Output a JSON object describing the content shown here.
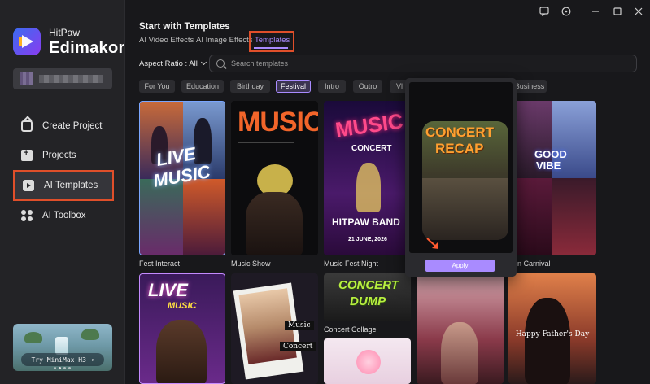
{
  "app": {
    "brand_top": "HitPaw",
    "brand_main": "Edimakor"
  },
  "sidebar": {
    "items": [
      {
        "label": "Create Project",
        "icon": "home-icon"
      },
      {
        "label": "Projects",
        "icon": "folder-icon"
      },
      {
        "label": "AI Templates",
        "icon": "template-icon",
        "active": true
      },
      {
        "label": "AI Toolbox",
        "icon": "toolbox-icon"
      }
    ],
    "promo_label": "Try MiniMax H3 ➔"
  },
  "header": {
    "title": "Start with Templates",
    "tabs": [
      {
        "label": "AI Video Effects"
      },
      {
        "label": "AI Image Effects"
      },
      {
        "label": "Templates",
        "active": true
      }
    ]
  },
  "filters": {
    "aspect_label": "Aspect Ratio : All",
    "search_placeholder": "Search templates"
  },
  "categories": [
    "For You",
    "Education",
    "Birthday",
    "Festival",
    "Intro",
    "Outro",
    "Vl",
    "Business"
  ],
  "active_category": "Festival",
  "cards_row1": [
    {
      "label": "Fest Interact",
      "art": [
        "LIVE",
        "MUSIC"
      ]
    },
    {
      "label": "Music Show",
      "art": [
        "MUSIC"
      ]
    },
    {
      "label": "Music Fest Night",
      "art": [
        "MUSIC",
        "CONCERT",
        "HITPAW BAND",
        "21 JUNE, 2026"
      ]
    },
    {
      "label": "n Carnival",
      "art": [
        "GOOD",
        "VIBE"
      ]
    }
  ],
  "cards_row2": [
    {
      "label": "",
      "art": [
        "LIVE",
        "MUSIC"
      ]
    },
    {
      "label": "",
      "art": [
        "Music",
        "Concert"
      ]
    },
    {
      "label": "Concert Collage",
      "art": [
        "CONCERT",
        "DUMP"
      ]
    },
    {
      "label": "",
      "art": []
    },
    {
      "label": "",
      "art": [
        "Happy Father's Day"
      ]
    }
  ],
  "preview": {
    "art": [
      "CONCERT",
      "RECAP"
    ],
    "apply_label": "Apply"
  },
  "colors": {
    "accent": "#a98bff",
    "highlight": "#e04f2a",
    "background": "#18181b",
    "sidebar": "#232326"
  }
}
